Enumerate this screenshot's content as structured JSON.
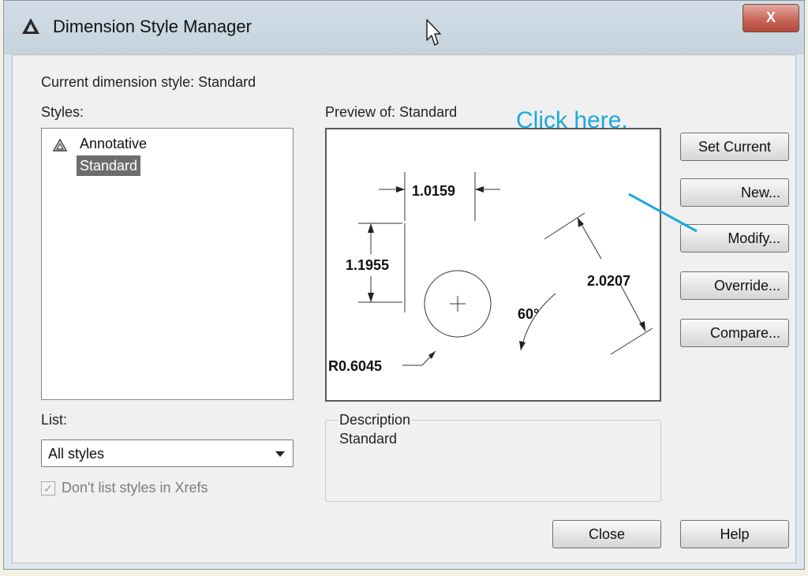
{
  "window": {
    "title": "Dimension Style Manager",
    "close_label": "X"
  },
  "current_style": {
    "label": "Current dimension style: Standard"
  },
  "styles": {
    "label": "Styles:",
    "items": [
      {
        "label": "Annotative",
        "icon": "annotative-icon"
      },
      {
        "label": "Standard",
        "selected": true
      }
    ]
  },
  "preview": {
    "label": "Preview of: Standard",
    "dims": {
      "horizontal": "1.0159",
      "vertical": "1.1955",
      "aligned": "2.0207",
      "angle": "60°",
      "radius": "R0.6045"
    }
  },
  "list": {
    "label": "List:",
    "selected": "All styles"
  },
  "xref_checkbox": {
    "label": "Don't list styles in Xrefs",
    "checked": true,
    "disabled": true
  },
  "description": {
    "legend": "Description",
    "text": "Standard"
  },
  "buttons": {
    "set_current": "Set Current",
    "new": "New...",
    "modify": "Modify...",
    "override": "Override...",
    "compare": "Compare...",
    "close": "Close",
    "help": "Help"
  },
  "callout": {
    "text": "Click here.",
    "color": "#1ea7dd"
  }
}
